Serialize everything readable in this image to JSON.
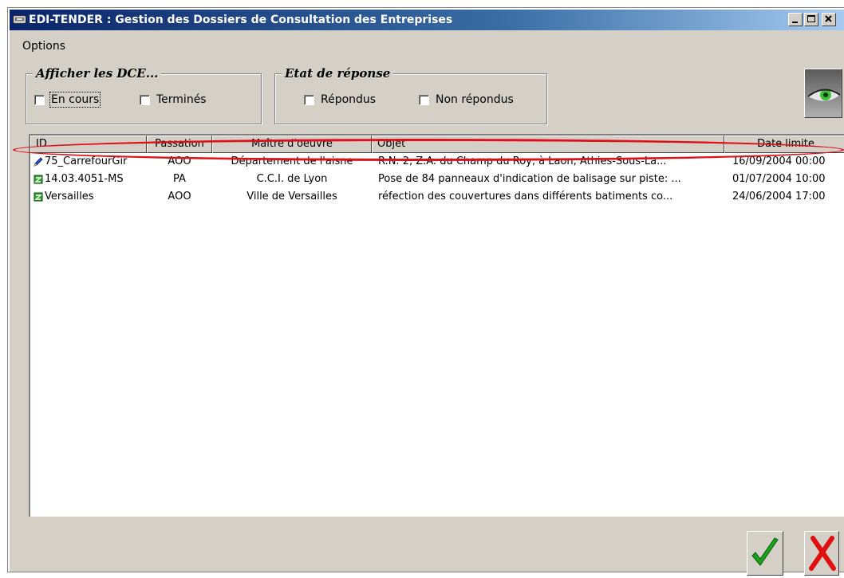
{
  "window": {
    "title": "EDI-TENDER : Gestion des Dossiers de Consultation des Entreprises",
    "icon": "app-icon"
  },
  "menu": {
    "options": "Options"
  },
  "filters": {
    "dce": {
      "legend": "Afficher les DCE...",
      "en_cours": "En cours",
      "termines": "Terminés"
    },
    "etat": {
      "legend": "Etat de réponse",
      "repondus": "Répondus",
      "non_repondus": "Non répondus"
    }
  },
  "table": {
    "columns": [
      "ID",
      "Passation",
      "Maître d'oeuvre",
      "Objet",
      "Date limite"
    ],
    "rows": [
      [
        "75_CarrefourGir",
        "AOO",
        "Département de l'aisne",
        "R.N. 2, Z.A. du Champ du Roy, à Laon, Athies-Sous-La...",
        "16/09/2004 00:00"
      ],
      [
        "14.03.4051-MS",
        "PA",
        "C.C.I. de Lyon",
        "Pose de 84 panneaux d'indication de balisage sur piste: ...",
        "01/07/2004 10:00"
      ],
      [
        "Versailles",
        "AOO",
        "Ville de Versailles",
        "réfection des couvertures dans différents batiments co...",
        "24/06/2004 17:00"
      ]
    ]
  },
  "colors": {
    "title_gradient_start": "#0a246a",
    "highlight": "#e0101a",
    "ok_green": "#1aa31a",
    "cancel_red": "#e01010"
  }
}
